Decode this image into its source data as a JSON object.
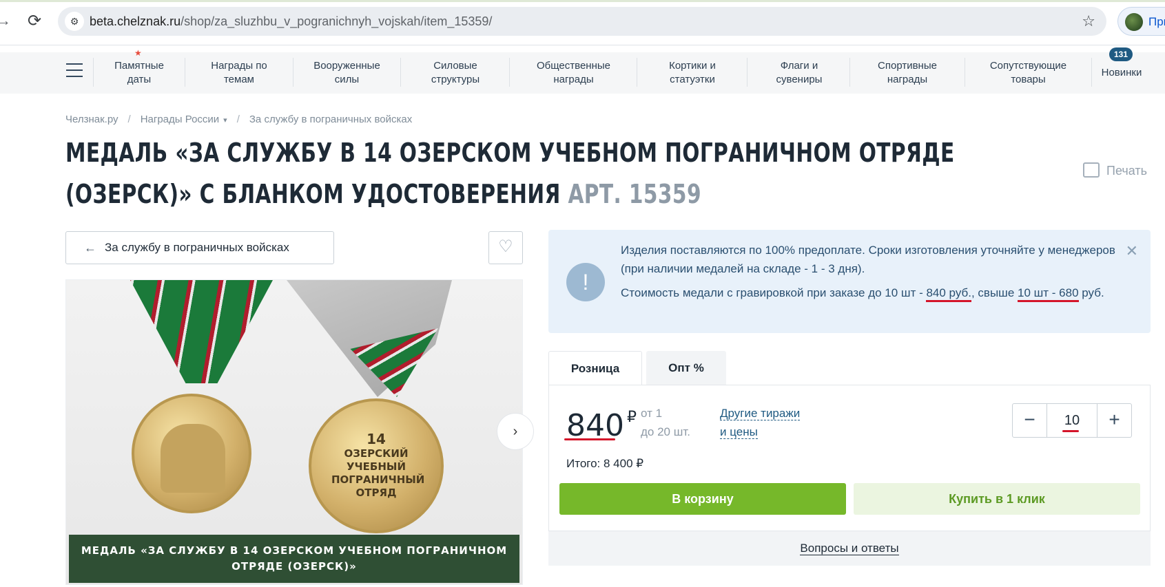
{
  "browser": {
    "url_host": "beta.chelznak.ru",
    "url_path": "/shop/za_sluzhbu_v_pogranichnyh_vojskah/item_15359/",
    "profile_name": "При"
  },
  "nav": {
    "items": [
      {
        "line1": "Памятные",
        "line2": "даты"
      },
      {
        "line1": "Награды по",
        "line2": "темам"
      },
      {
        "line1": "Вооруженные",
        "line2": "силы"
      },
      {
        "line1": "Силовые",
        "line2": "структуры"
      },
      {
        "line1": "Общественные",
        "line2": "награды"
      },
      {
        "line1": "Кортики и",
        "line2": "статуэтки"
      },
      {
        "line1": "Флаги и",
        "line2": "сувениры"
      },
      {
        "line1": "Спортивные",
        "line2": "награды"
      },
      {
        "line1": "Сопутствующие",
        "line2": "товары"
      },
      {
        "line1": "Новинки",
        "line2": ""
      }
    ],
    "new_count": "131"
  },
  "breadcrumb": [
    "Челзнак.ру",
    "Награды России",
    "За службу в пограничных войсках"
  ],
  "title": {
    "main": "Медаль «За службу в 14 Озерском учебном пограничном отряде (Озерск)» с бланком удостоверения",
    "art": "Арт. 15359"
  },
  "print_label": "Печать",
  "back_label": "За службу в пограничных войсках",
  "image": {
    "medal_number": "14",
    "medal_text": "ОЗЕРСКИЙ УЧЕБНЫЙ ПОГРАНИЧНЫЙ ОТРЯД",
    "caption": "МЕДАЛЬ «ЗА СЛУЖБУ В 14 ОЗЕРСКОМ УЧЕБНОМ ПОГРАНИЧНОМ ОТРЯДЕ (ОЗЕРСК)»"
  },
  "info": {
    "line1": "Изделия поставляются по 100% предоплате. Сроки изготовления уточняйте у менеджеров (при наличии медалей на складе - 1 - 3 дня).",
    "line2_a": "Стоимость медали с гравировкой при заказе до 10 шт - ",
    "line2_b": "840 руб.",
    "line2_c": ", свыше ",
    "line2_d": "10 шт - 680",
    "line2_e": " руб."
  },
  "tabs": {
    "retail": "Розница",
    "wholesale": "Опт %"
  },
  "price": {
    "value": "840",
    "currency": "₽",
    "range_from": "от 1",
    "range_to": "до 20 шт.",
    "other_line1": "Другие тиражи",
    "other_line2": "и цены",
    "quantity": "10",
    "total": "Итого: 8 400 ₽"
  },
  "buttons": {
    "cart": "В корзину",
    "one_click": "Купить в 1 клик"
  },
  "qa_label": "Вопросы и ответы",
  "colors": {
    "accent_green": "#76b82a",
    "brand_blue": "#1f5a82",
    "annotation_red": "#d4152a"
  }
}
